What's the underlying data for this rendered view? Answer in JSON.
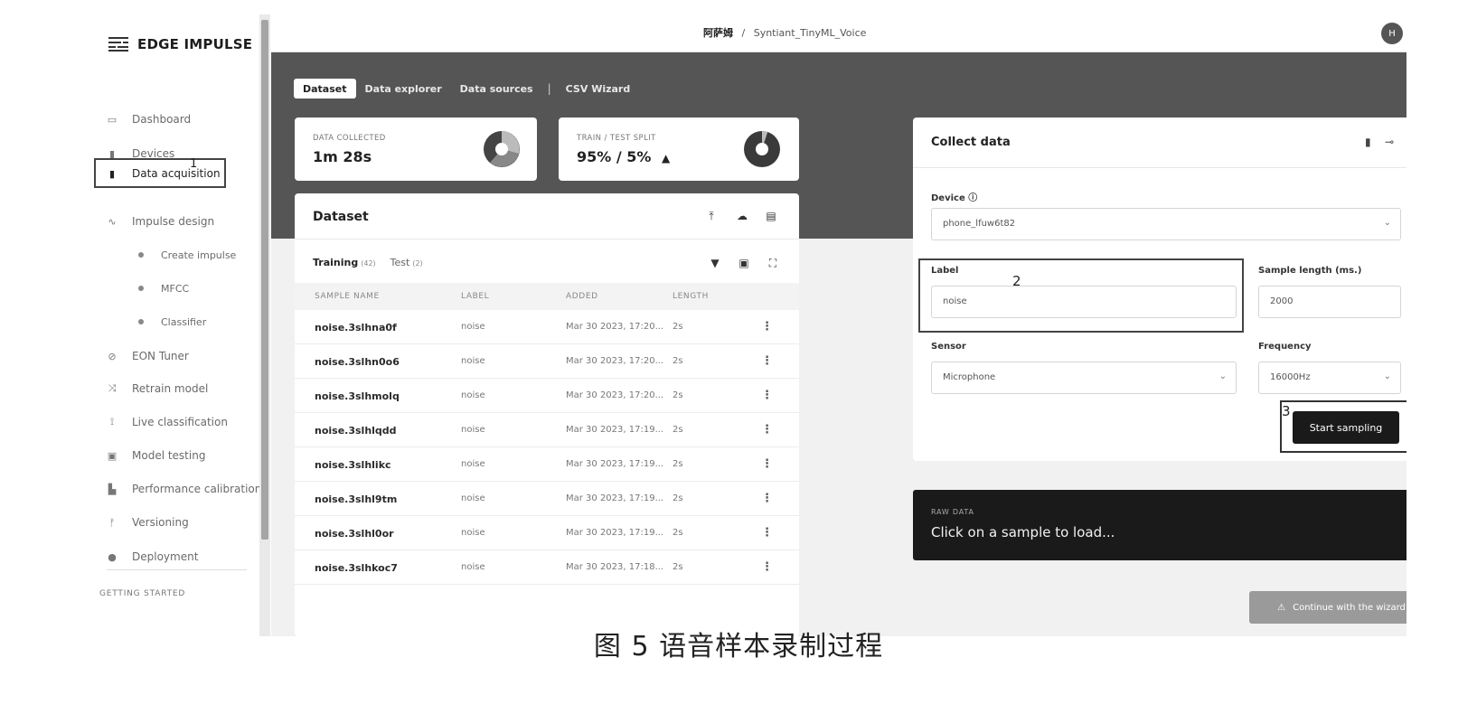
{
  "brand": {
    "name": "EDGE IMPULSE"
  },
  "sidebar": {
    "items": [
      {
        "icon": "monitor-icon",
        "glyph": "▭",
        "label": "Dashboard"
      },
      {
        "icon": "devices-icon",
        "glyph": "▮",
        "label": "Devices"
      },
      {
        "icon": "database-icon",
        "glyph": "▮",
        "label": "Data acquisition"
      },
      {
        "icon": "pulse-icon",
        "glyph": "∿",
        "label": "Impulse design"
      },
      {
        "icon": "dot-icon",
        "label": "Create impulse"
      },
      {
        "icon": "dot-icon",
        "label": "MFCC"
      },
      {
        "icon": "dot-icon",
        "label": "Classifier"
      },
      {
        "icon": "tuner-icon",
        "glyph": "⊘",
        "label": "EON Tuner"
      },
      {
        "icon": "retrain-icon",
        "glyph": "⤨",
        "label": "Retrain model"
      },
      {
        "icon": "live-icon",
        "glyph": "⟟",
        "label": "Live classification"
      },
      {
        "icon": "clipboard-icon",
        "glyph": "▣",
        "label": "Model testing"
      },
      {
        "icon": "bar-chart-icon",
        "glyph": "▙",
        "label": "Performance calibration"
      },
      {
        "icon": "branch-icon",
        "glyph": "ᚠ",
        "label": "Versioning"
      },
      {
        "icon": "package-icon",
        "glyph": "●",
        "label": "Deployment"
      }
    ],
    "section": "GETTING STARTED"
  },
  "annotations": {
    "a1": "1",
    "a2": "2",
    "a3": "3"
  },
  "topbar": {
    "owner": "阿萨姆",
    "sep": "/",
    "project": "Syntiant_TinyML_Voice",
    "avatar": "H"
  },
  "tabs": [
    {
      "label": "Dataset"
    },
    {
      "label": "Data explorer"
    },
    {
      "label": "Data sources"
    },
    {
      "label": "CSV Wizard"
    }
  ],
  "tab_separator": "|",
  "stats": {
    "collected": {
      "caption": "DATA COLLECTED",
      "value": "1m 28s"
    },
    "split": {
      "caption": "TRAIN / TEST SPLIT",
      "value": "95% / 5%",
      "warning": "▲",
      "train_percent": 95,
      "test_percent": 5
    }
  },
  "dataset": {
    "title": "Dataset",
    "tabs": [
      {
        "label": "Training",
        "count": "(42)"
      },
      {
        "label": "Test",
        "count": "(2)"
      }
    ],
    "columns": [
      "SAMPLE NAME",
      "LABEL",
      "ADDED",
      "LENGTH"
    ],
    "rows": [
      {
        "name": "noise.3slhna0f",
        "label": "noise",
        "added": "Mar 30 2023, 17:20...",
        "length": "2s"
      },
      {
        "name": "noise.3slhn0o6",
        "label": "noise",
        "added": "Mar 30 2023, 17:20...",
        "length": "2s"
      },
      {
        "name": "noise.3slhmolq",
        "label": "noise",
        "added": "Mar 30 2023, 17:20...",
        "length": "2s"
      },
      {
        "name": "noise.3slhlqdd",
        "label": "noise",
        "added": "Mar 30 2023, 17:19...",
        "length": "2s"
      },
      {
        "name": "noise.3slhlikc",
        "label": "noise",
        "added": "Mar 30 2023, 17:19...",
        "length": "2s"
      },
      {
        "name": "noise.3slhl9tm",
        "label": "noise",
        "added": "Mar 30 2023, 17:19...",
        "length": "2s"
      },
      {
        "name": "noise.3slhl0or",
        "label": "noise",
        "added": "Mar 30 2023, 17:19...",
        "length": "2s"
      },
      {
        "name": "noise.3slhkoc7",
        "label": "noise",
        "added": "Mar 30 2023, 17:18...",
        "length": "2s"
      }
    ],
    "row_menu": "⋮"
  },
  "collect": {
    "title": "Collect data",
    "device_label": "Device ⓘ",
    "device_value": "phone_lfuw6t82",
    "label_label": "Label",
    "label_value": "noise",
    "length_label": "Sample length (ms.)",
    "length_value": "2000",
    "sensor_label": "Sensor",
    "sensor_value": "Microphone",
    "freq_label": "Frequency",
    "freq_value": "16000Hz",
    "start_label": "Start sampling"
  },
  "raw": {
    "caption": "RAW DATA",
    "message": "Click on a sample to load..."
  },
  "wizard": {
    "label": "Continue with the wizard"
  },
  "caption": "图 5 语音样本录制过程"
}
